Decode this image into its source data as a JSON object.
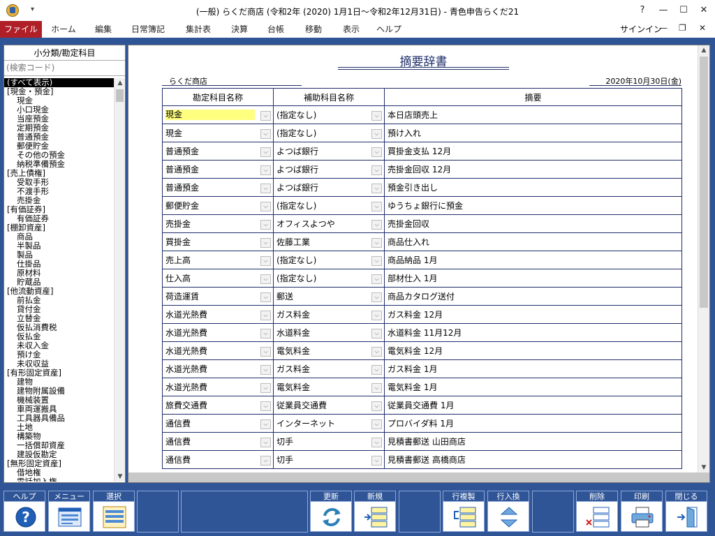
{
  "window": {
    "title": "(一般) らくだ商店 (令和2年 (2020) 1月1日〜令和2年12月31日) - 青色申告らくだ21",
    "help": "?",
    "minimize": "—",
    "maximize": "☐",
    "close": "✕"
  },
  "menubar": {
    "items": [
      "ファイル",
      "ホーム",
      "編集",
      "日常簿記",
      "集計表",
      "決算",
      "台帳",
      "移動",
      "表示",
      "ヘルプ"
    ],
    "signin": "サインイン"
  },
  "sidebar": {
    "title": "小分類/勘定科目",
    "search_placeholder": "(検索コード)",
    "items": [
      {
        "label": "(すべて表示)",
        "type": "selected"
      },
      {
        "label": "[現金・預金]",
        "type": "cat"
      },
      {
        "label": "現金",
        "type": "item"
      },
      {
        "label": "小口現金",
        "type": "item"
      },
      {
        "label": "当座預金",
        "type": "item"
      },
      {
        "label": "定期預金",
        "type": "item"
      },
      {
        "label": "普通預金",
        "type": "item"
      },
      {
        "label": "郵便貯金",
        "type": "item"
      },
      {
        "label": "その他の預金",
        "type": "item"
      },
      {
        "label": "納税準備預金",
        "type": "item"
      },
      {
        "label": "[売上債権]",
        "type": "cat"
      },
      {
        "label": "受取手形",
        "type": "item"
      },
      {
        "label": "不渡手形",
        "type": "item"
      },
      {
        "label": "売掛金",
        "type": "item"
      },
      {
        "label": "[有価証券]",
        "type": "cat"
      },
      {
        "label": "有価証券",
        "type": "item"
      },
      {
        "label": "[棚卸資産]",
        "type": "cat"
      },
      {
        "label": "商品",
        "type": "item"
      },
      {
        "label": "半製品",
        "type": "item"
      },
      {
        "label": "製品",
        "type": "item"
      },
      {
        "label": "仕掛品",
        "type": "item"
      },
      {
        "label": "原材料",
        "type": "item"
      },
      {
        "label": "貯蔵品",
        "type": "item"
      },
      {
        "label": "[他流動資産]",
        "type": "cat"
      },
      {
        "label": "前払金",
        "type": "item"
      },
      {
        "label": "貸付金",
        "type": "item"
      },
      {
        "label": "立替金",
        "type": "item"
      },
      {
        "label": "仮払消費税",
        "type": "item"
      },
      {
        "label": "仮払金",
        "type": "item"
      },
      {
        "label": "未収入金",
        "type": "item"
      },
      {
        "label": "預け金",
        "type": "item"
      },
      {
        "label": "未収収益",
        "type": "item"
      },
      {
        "label": "[有形固定資産]",
        "type": "cat"
      },
      {
        "label": "建物",
        "type": "item"
      },
      {
        "label": "建物附属設備",
        "type": "item"
      },
      {
        "label": "機械装置",
        "type": "item"
      },
      {
        "label": "車両運搬具",
        "type": "item"
      },
      {
        "label": "工具器具備品",
        "type": "item"
      },
      {
        "label": "土地",
        "type": "item"
      },
      {
        "label": "構築物",
        "type": "item"
      },
      {
        "label": "一括償却資産",
        "type": "item"
      },
      {
        "label": "建設仮勘定",
        "type": "item"
      },
      {
        "label": "[無形固定資産]",
        "type": "cat"
      },
      {
        "label": "借地権",
        "type": "item"
      },
      {
        "label": "電話加入権",
        "type": "item"
      }
    ]
  },
  "dictionary": {
    "title": "摘要辞書",
    "company": "らくだ商店",
    "date": "2020年10月30日(金)",
    "headers": [
      "勘定科目名称",
      "補助科目名称",
      "摘要"
    ],
    "rows": [
      [
        "現金",
        "(指定なし)",
        "本日店頭売上"
      ],
      [
        "現金",
        "(指定なし)",
        "預け入れ"
      ],
      [
        "普通預金",
        "よつば銀行",
        "買掛金支払 12月"
      ],
      [
        "普通預金",
        "よつば銀行",
        "売掛金回収 12月"
      ],
      [
        "普通預金",
        "よつば銀行",
        "預金引き出し"
      ],
      [
        "郵便貯金",
        "(指定なし)",
        "ゆうちょ銀行に預金"
      ],
      [
        "売掛金",
        "オフィスよつや",
        "売掛金回収"
      ],
      [
        "買掛金",
        "佐藤工業",
        "商品仕入れ"
      ],
      [
        "売上高",
        "(指定なし)",
        "商品納品 1月"
      ],
      [
        "仕入高",
        "(指定なし)",
        "部材仕入 1月"
      ],
      [
        "荷造運賃",
        "郵送",
        "商品カタログ送付"
      ],
      [
        "水道光熱費",
        "ガス料金",
        "ガス料金 12月"
      ],
      [
        "水道光熱費",
        "水道料金",
        "水道料金 11月12月"
      ],
      [
        "水道光熱費",
        "電気料金",
        "電気料金 12月"
      ],
      [
        "水道光熱費",
        "ガス料金",
        "ガス料金 1月"
      ],
      [
        "水道光熱費",
        "電気料金",
        "電気料金 1月"
      ],
      [
        "旅費交通費",
        "従業員交通費",
        "従業員交通費 1月"
      ],
      [
        "通信費",
        "インターネット",
        "プロバイダ料 1月"
      ],
      [
        "通信費",
        "切手",
        "見積書郵送 山田商店"
      ],
      [
        "通信費",
        "切手",
        "見積書郵送 高橋商店"
      ]
    ]
  },
  "toolbar": {
    "help": "ヘルプ",
    "menu": "メニュー",
    "select": "選択",
    "refresh": "更新",
    "new": "新規",
    "copy_row": "行複製",
    "swap_row": "行入換",
    "delete": "削除",
    "print": "印刷",
    "close": "閉じる"
  },
  "colors": {
    "frame": "#2f5597",
    "file_menu": "#b01f27",
    "highlight": "#ffff7f"
  }
}
